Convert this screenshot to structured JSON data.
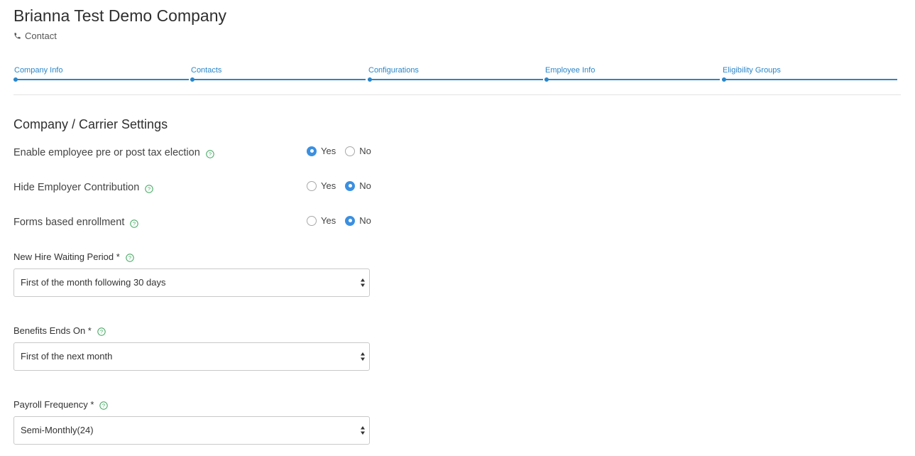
{
  "header": {
    "company_name": "Brianna Test Demo Company",
    "contact_label": "Contact"
  },
  "stepper": {
    "steps": [
      {
        "label": "Company Info"
      },
      {
        "label": "Contacts"
      },
      {
        "label": "Configurations"
      },
      {
        "label": "Employee Info"
      },
      {
        "label": "Eligibility Groups"
      }
    ]
  },
  "section": {
    "title": "Company / Carrier Settings"
  },
  "settings": [
    {
      "label": "Enable employee pre or post tax election",
      "yes_label": "Yes",
      "no_label": "No",
      "selected": "Yes"
    },
    {
      "label": "Hide Employer Contribution",
      "yes_label": "Yes",
      "no_label": "No",
      "selected": "No"
    },
    {
      "label": "Forms based enrollment",
      "yes_label": "Yes",
      "no_label": "No",
      "selected": "No"
    }
  ],
  "fields": [
    {
      "label": "New Hire Waiting Period *",
      "value": "First of the month following 30 days"
    },
    {
      "label": "Benefits Ends On *",
      "value": "First of the next month"
    },
    {
      "label": "Payroll Frequency *",
      "value": "Semi-Monthly(24)"
    }
  ],
  "colors": {
    "accent": "#2a86c8",
    "radio_checked": "#3b8fe0",
    "help_icon": "#3aa55a"
  }
}
